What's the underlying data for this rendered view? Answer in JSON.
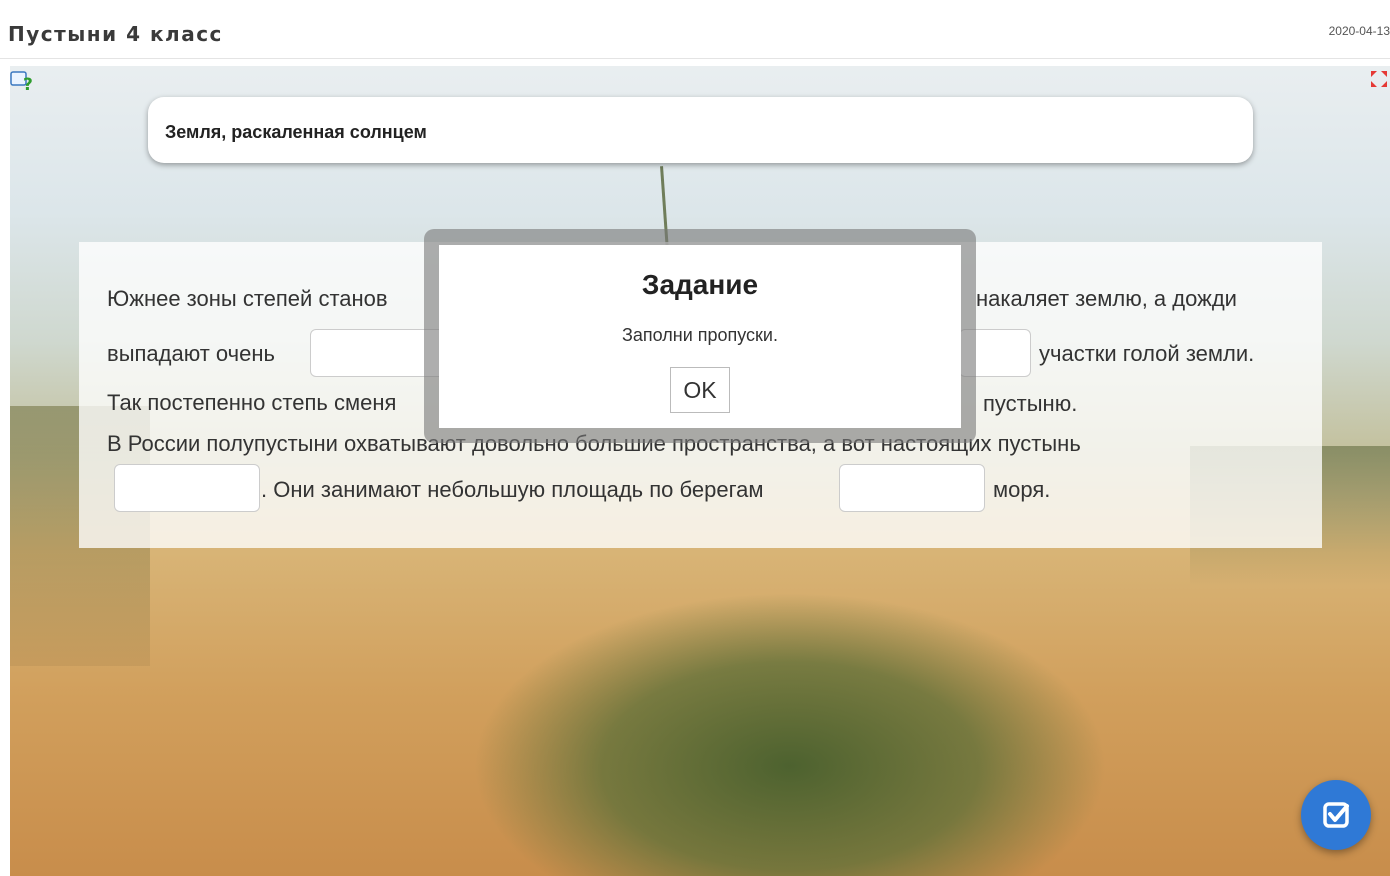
{
  "header": {
    "title": "Пустыни 4 класс",
    "date": "2020-04-13"
  },
  "card": {
    "title": "Земля, раскаленная солнцем"
  },
  "exercise": {
    "line1_start": "Южнее зоны степей станов",
    "line1_end": "накаляет землю, а дожди",
    "line2_start": "выпадают очень",
    "line2_end": "участки голой земли.",
    "line3_start": "Так постепенно степь сменя",
    "line3_end": "пустыню.",
    "line4": "В России полупустыни охватывают довольно большие пространства, а вот настоящих пустынь",
    "line5_mid": ". Они занимают небольшую площадь по берегам",
    "line5_end": "моря."
  },
  "modal": {
    "title": "Задание",
    "message": "Заполни пропуски.",
    "ok_label": "OK"
  },
  "icons": {
    "help": "help-icon",
    "fullscreen": "fullscreen-icon",
    "check": "check-icon"
  },
  "colors": {
    "accent": "#2f79d6",
    "fullscreen_red": "#e53935"
  }
}
